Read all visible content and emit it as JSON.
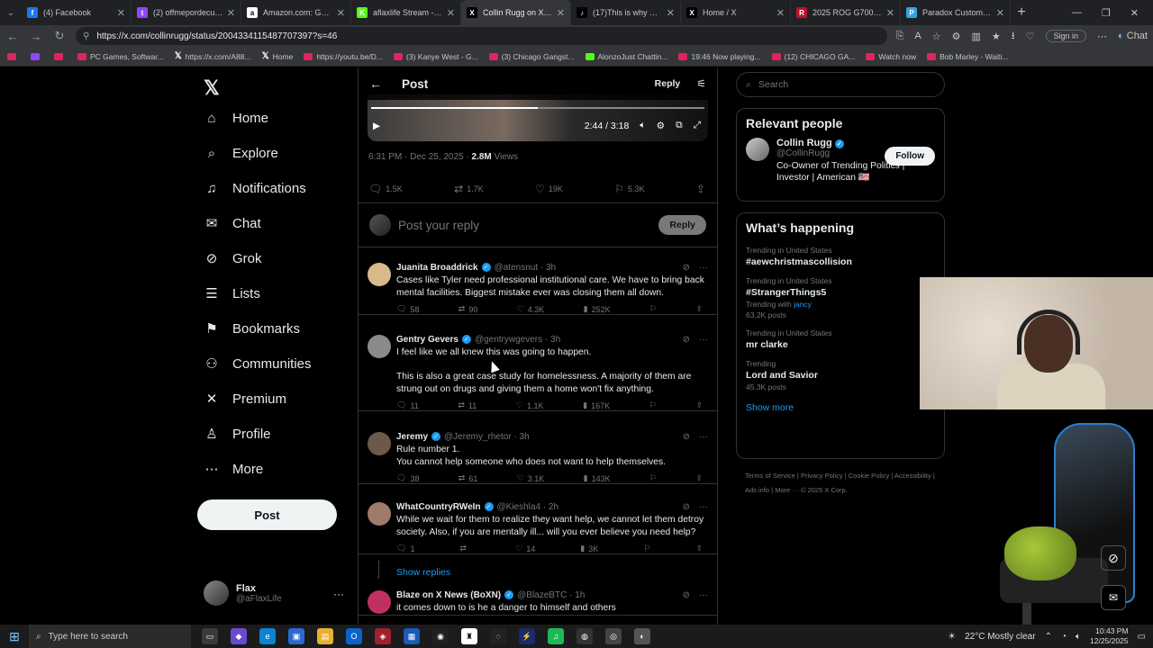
{
  "browser": {
    "tabs": [
      {
        "title": "(4) Facebook",
        "color": "#1877f2",
        "glyph": "f",
        "active": false
      },
      {
        "title": "(2) offmepordecurb - Tw",
        "color": "#9146ff",
        "glyph": "t",
        "active": false
      },
      {
        "title": "Amazon.com: Gaming P",
        "color": "#ffffff",
        "glyph": "a",
        "active": false
      },
      {
        "title": "aflaxlife Stream - W",
        "color": "#53fc18",
        "glyph": "K",
        "active": false
      },
      {
        "title": "Collin Rugg on X: \"I",
        "color": "#000000",
        "glyph": "X",
        "active": true
      },
      {
        "title": "(17)This is why Hassan C",
        "color": "#000000",
        "glyph": "♪",
        "active": false
      },
      {
        "title": "Home / X",
        "color": "#000000",
        "glyph": "X",
        "active": false
      },
      {
        "title": "2025 ROG G700 | Full To",
        "color": "#c0102f",
        "glyph": "R",
        "active": false
      },
      {
        "title": "Paradox Customs Corsai",
        "color": "#2fa4e7",
        "glyph": "P",
        "active": false
      }
    ],
    "url": "https://x.com/collinrugg/status/2004334115487707397?s=46",
    "signin_label": "Sign in",
    "chat_label": "Chat",
    "bookmarks": [
      {
        "label": "",
        "type": "yt"
      },
      {
        "label": "",
        "type": "tw"
      },
      {
        "label": "",
        "type": "yt"
      },
      {
        "label": "PC Games, Softwar...",
        "type": "yt"
      },
      {
        "label": "https://x.com/A88...",
        "type": "x"
      },
      {
        "label": "Home",
        "type": "x"
      },
      {
        "label": "https://youtu.be/D...",
        "type": "yt"
      },
      {
        "label": "(3) Kanye West - G...",
        "type": "yt"
      },
      {
        "label": "(3) Chicago Gangst...",
        "type": "yt"
      },
      {
        "label": "AlonzoJust Chattin...",
        "type": "k"
      },
      {
        "label": "19:46 Now playing...",
        "type": "yt"
      },
      {
        "label": "(12) CHICAGO GA...",
        "type": "yt"
      },
      {
        "label": "Watch now",
        "type": "yt"
      },
      {
        "label": "Bob Marley - Waiti...",
        "type": "yt"
      }
    ]
  },
  "nav": {
    "items": [
      {
        "label": "Home",
        "icon": "home-icon",
        "glyph": "⌂"
      },
      {
        "label": "Explore",
        "icon": "search-icon",
        "glyph": "⌕"
      },
      {
        "label": "Notifications",
        "icon": "bell-icon",
        "glyph": "♫"
      },
      {
        "label": "Chat",
        "icon": "mail-icon",
        "glyph": "✉"
      },
      {
        "label": "Grok",
        "icon": "grok-icon",
        "glyph": "⊘"
      },
      {
        "label": "Lists",
        "icon": "list-icon",
        "glyph": "☰"
      },
      {
        "label": "Bookmarks",
        "icon": "bookmark-icon",
        "glyph": "⚑"
      },
      {
        "label": "Communities",
        "icon": "people-icon",
        "glyph": "⚇"
      },
      {
        "label": "Premium",
        "icon": "x-icon",
        "glyph": "✕"
      },
      {
        "label": "Profile",
        "icon": "person-icon",
        "glyph": "♙"
      },
      {
        "label": "More",
        "icon": "more-icon",
        "glyph": "⋯"
      }
    ],
    "post_label": "Post",
    "user": {
      "name": "Flax",
      "handle": "@aFlaxLife"
    }
  },
  "main": {
    "title": "Post",
    "reply_header": "Reply",
    "video": {
      "time": "2:44 / 3:18",
      "progress": 0.5
    },
    "meta": {
      "time": "6:31 PM · Dec 25, 2025 · ",
      "views": "2.8M",
      "views_label": " Views"
    },
    "stats": {
      "replies": "1.5K",
      "reposts": "1.7K",
      "likes": "19K",
      "bookmarks": "5.3K"
    },
    "reply_placeholder": "Post your reply",
    "reply_button": "Reply",
    "replies": [
      {
        "name": "Juanita Broaddrick",
        "handle": "@atensnut · 3h",
        "text": "Cases like Tyler need professional institutional care.  We have to bring back mental facilities. Biggest mistake ever was closing them all down.",
        "replies": "58",
        "reposts": "90",
        "likes": "4.3K",
        "views": "252K",
        "avatar": "#d9b98a"
      },
      {
        "name": "Gentry Gevers",
        "handle": "@gentrywgevers · 3h",
        "text": "I feel like we all knew this was going to happen.\n\nThis is also a great case study for homelessness. A majority of them are strung out on drugs and giving them a home won't fix anything.",
        "replies": "11",
        "reposts": "11",
        "likes": "1.1K",
        "views": "167K",
        "avatar": "#8a8a8a"
      },
      {
        "name": "Jeremy",
        "handle": "@Jeremy_rhetor · 3h",
        "text": "Rule number 1.\nYou cannot help someone who does not want to help themselves.",
        "replies": "38",
        "reposts": "61",
        "likes": "3.1K",
        "views": "143K",
        "avatar": "#6b5a4a"
      },
      {
        "name": "WhatCountryRWeIn",
        "handle": "@Kieshla4 · 2h",
        "text": "While we wait for them to realize they want help, we cannot let them detroy society. Also, if you are mentally ill... will you ever believe you need help?",
        "replies": "1",
        "reposts": "",
        "likes": "14",
        "views": "3K",
        "avatar": "#a07a6a"
      },
      {
        "name": "Blaze on X News (BoXN)",
        "handle": "@BlazeBTC · 1h",
        "text": "it comes down to is he a danger to himself and others",
        "replies": "",
        "reposts": "",
        "likes": "",
        "views": "",
        "avatar": "#c03060"
      }
    ],
    "show_replies": "Show replies"
  },
  "right": {
    "search_placeholder": "Search",
    "relevant_title": "Relevant people",
    "person": {
      "name": "Collin Rugg",
      "handle": "@CollinRugg",
      "bio": "Co-Owner of Trending Politics | Investor | American 🇺🇸",
      "follow": "Follow"
    },
    "happening_title": "What’s happening",
    "trends": [
      {
        "cap": "Trending in United States",
        "name": "#aewchristmascollision",
        "sub": "",
        "link": ""
      },
      {
        "cap": "Trending in United States",
        "name": "#StrangerThings5",
        "sub": "Trending with ",
        "link": "jancy",
        "posts": "63.2K posts"
      },
      {
        "cap": "Trending in United States",
        "name": "mr clarke",
        "sub": "",
        "link": ""
      },
      {
        "cap": "Trending",
        "name": "Lord and Savior",
        "sub": "45.3K posts",
        "link": ""
      }
    ],
    "show_more": "Show more",
    "footer": "Terms of Service  |  Privacy Policy  |  Cookie Policy  |  Accessibility  |  Ads info  |  More ···  © 2025 X Corp."
  },
  "taskbar": {
    "search_placeholder": "Type here to search",
    "weather": "22°C  Mostly clear",
    "time": "10:43 PM",
    "date": "12/25/2025"
  }
}
